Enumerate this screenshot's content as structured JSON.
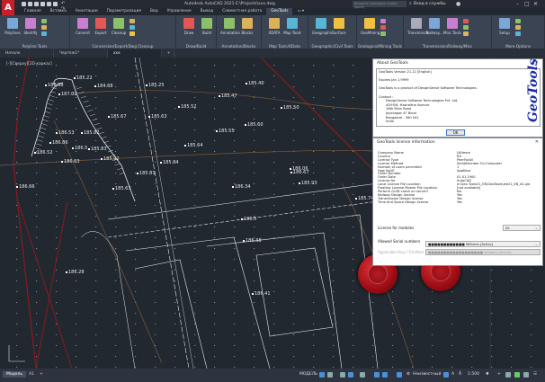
{
  "app": {
    "title": "Autodesk AutoCAD 2021   E:\\Projects\\xxx.dwg",
    "search_placeholder": "Введите ключевое слово/фразу",
    "signin": "Вход в службы",
    "logo": "A"
  },
  "menu_tabs": [
    "Главная",
    "Вставка",
    "Аннотации",
    "Параметризация",
    "Вид",
    "Управление",
    "Вывод",
    "Совместная работа",
    "GeoTools",
    "▭ ▾"
  ],
  "active_menu_tab": "GeoTools",
  "ribbon": {
    "panels": [
      {
        "label": "Polyline Tools",
        "tools": [
          "Polylines",
          "Identify"
        ]
      },
      {
        "label": "Conversion/Export/Dwg Cleanup",
        "tools": [
          "Convert",
          "Export",
          "Cleanup"
        ]
      },
      {
        "label": "Draw/Build",
        "tools": [
          "Draw",
          "Build"
        ]
      },
      {
        "label": "Annotation/Blocks",
        "tools": [
          "Annotation",
          "Blocks"
        ]
      },
      {
        "label": "Map Tools/XData",
        "tools": [
          "XDATA",
          "Map Tools"
        ]
      },
      {
        "label": "Geographic/Civil Tools",
        "tools": [
          "Geographic",
          "Surface"
        ]
      },
      {
        "label": "Geological/Mining Tools",
        "tools": [
          "GeoMining"
        ]
      },
      {
        "label": "Transmission/Railway/Misc",
        "tools": [
          "Transmission",
          "Railway...",
          "Misc Tools"
        ]
      },
      {
        "label": "More Options",
        "tools": [
          "Setup"
        ]
      }
    ]
  },
  "doc_tabs": [
    "Начало",
    "Чертеж1*",
    "xxx",
    "+"
  ],
  "active_doc_tab": "xxx",
  "drawing": {
    "view_label": "[-][Сверху][2D-каркас]",
    "elevations": [
      "185.22",
      "186.98",
      "187.02",
      "184.68",
      "185.25",
      "185.40",
      "185.47",
      "185.52",
      "185.50",
      "185.67",
      "185.63",
      "185.60",
      "185.55",
      "186.53",
      "185.82",
      "185.64",
      "186.86",
      "186.5",
      "185.83",
      "186.52",
      "185.92",
      "185.84",
      "186.63",
      "185.81",
      "185.74",
      "186.66",
      "185.63",
      "186.34",
      "186.5",
      "186.38",
      "186.28",
      "186.41",
      "186.67",
      "186.06",
      "185.93"
    ],
    "colors": {
      "background": "#212830",
      "boundary": "#8b1a1f",
      "contour": "#7a5a3a",
      "lines": "#e6e9ee"
    }
  },
  "about_dialog": {
    "title": "About GeoTools",
    "version": "GeoTools Version 21.12 [English]",
    "expires": "Expires Jan 1,9999",
    "product": "GeoTools is a product of DesignSense Software Technologies.",
    "contact_label": "Contact :",
    "contact": [
      "DesignSense Software Technologies Pvt. Ltd.",
      "#295/8, Hasheltha Avenue",
      "16th Main Road",
      "Jayanagar 4T Block",
      "Bangalore - 560 041",
      "India"
    ],
    "logo_text": "GeoTools",
    "ok": "OK"
  },
  "license_dialog": {
    "title": "GeoTools license information",
    "rows": [
      [
        "Company Name",
        "LKHeam"
      ],
      [
        "Country",
        "RU"
      ],
      [
        "License Type",
        "PeerForAll"
      ],
      [
        "License Method",
        "SerialNumber-On-Computer"
      ],
      [
        "Number of users permitted",
        "1"
      ],
      [
        "How Sold?",
        "AppKeys"
      ],
      [
        "Order Number",
        ""
      ],
      [
        "Order Date",
        "01.01.1900"
      ],
      [
        "License for",
        "AutoCAD"
      ],
      [
        "Local License File Location",
        "e:\\Geo Tools21_EN\\GeoTools\\lee21_EN_AC.gls"
      ],
      [
        "Floating License Master File Location",
        "[not available]"
      ],
      [
        "Perform GUID check on server?",
        "No"
      ],
      [
        "Railway Design license",
        "Yes"
      ],
      [
        "Transmission Design license",
        "Yes"
      ],
      [
        "Time And Space Design license",
        "Yes"
      ]
    ],
    "modules_label": "License for modules",
    "modules_value": "All",
    "serials_label": "Allowed Serial numbers",
    "serials_value": "■■■■■■■■■■■■ Williams [Active]",
    "applicable_label": "Applicable Keys / Emitted",
    "applicable_value": "■■■■■■■■■■■■■■■■■■ Williams [Active]"
  },
  "status": {
    "layout_tabs": [
      "Модель",
      "A1",
      "+"
    ],
    "active_layout": "Модель",
    "model": "МОДЕЛЬ",
    "annotative": "Неизвестный",
    "scale": "1:500"
  }
}
